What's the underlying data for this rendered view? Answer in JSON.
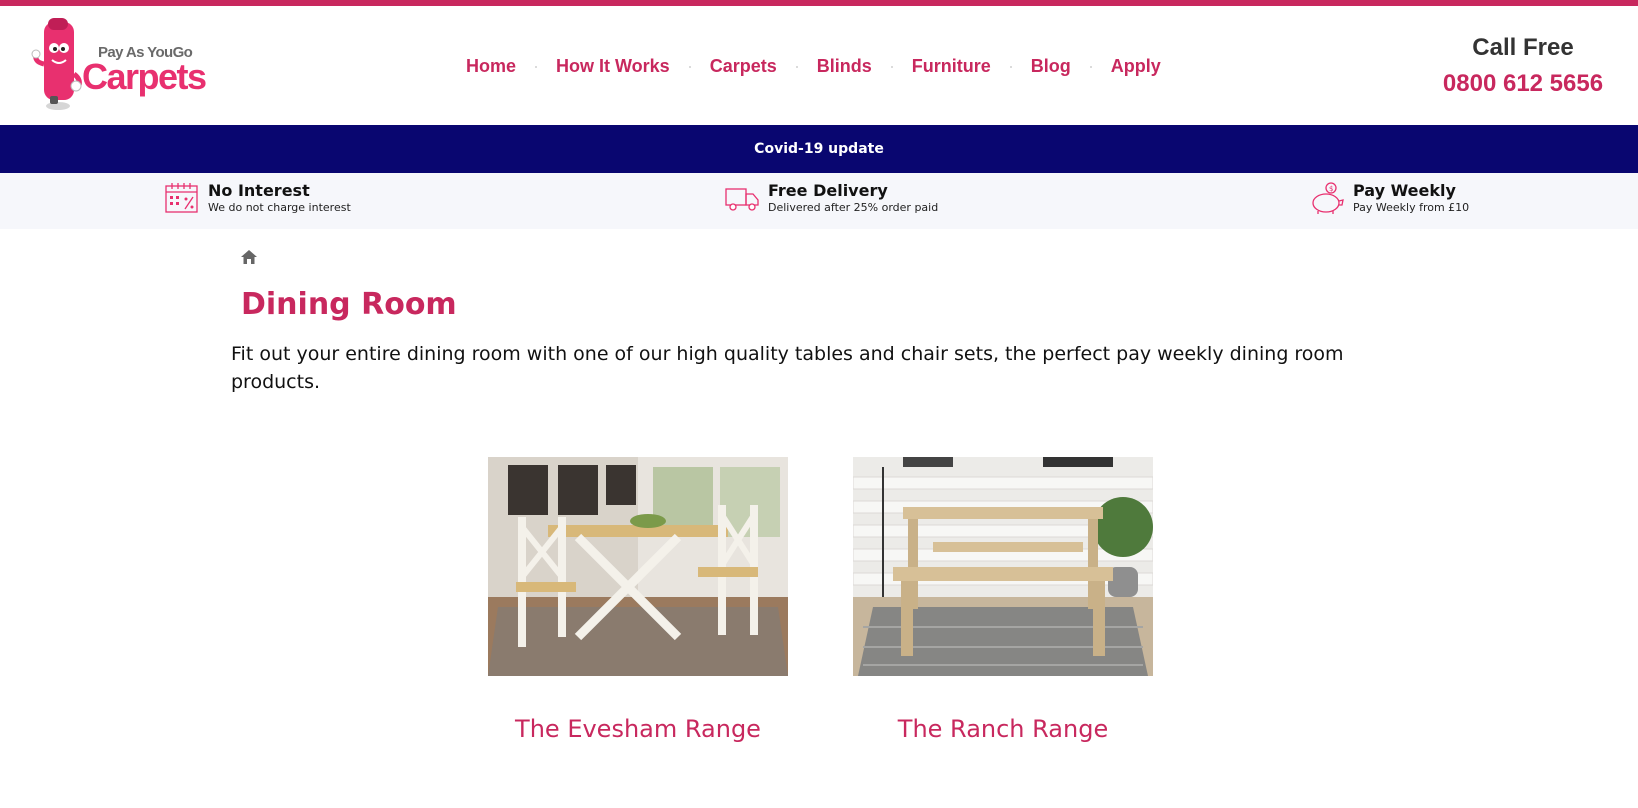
{
  "header": {
    "logo": {
      "line1": "Pay As YouGo",
      "line2": "Carpets"
    },
    "nav": [
      {
        "label": "Home"
      },
      {
        "label": "How It Works"
      },
      {
        "label": "Carpets"
      },
      {
        "label": "Blinds"
      },
      {
        "label": "Furniture"
      },
      {
        "label": "Blog"
      },
      {
        "label": "Apply"
      }
    ],
    "call": {
      "label": "Call Free",
      "number": "0800 612 5656"
    }
  },
  "banner": {
    "text": "Covid-19 update"
  },
  "features": [
    {
      "icon": "calendar-percent-icon",
      "title": "No Interest",
      "subtitle": "We do not charge interest"
    },
    {
      "icon": "delivery-truck-icon",
      "title": "Free Delivery",
      "subtitle": "Delivered after 25% order paid"
    },
    {
      "icon": "piggy-bank-icon",
      "title": "Pay Weekly",
      "subtitle": "Pay Weekly from £10"
    }
  ],
  "breadcrumb": {
    "icon": "home-icon"
  },
  "page": {
    "title": "Dining Room",
    "intro": "Fit out your entire dining room with one of our high quality tables and chair sets, the perfect pay weekly dining room products."
  },
  "products": [
    {
      "name": "The Evesham Range"
    },
    {
      "name": "The Ranch Range"
    }
  ],
  "colors": {
    "brand": "#c8285e",
    "banner": "#090670",
    "feature_bg": "#f6f7fb"
  }
}
